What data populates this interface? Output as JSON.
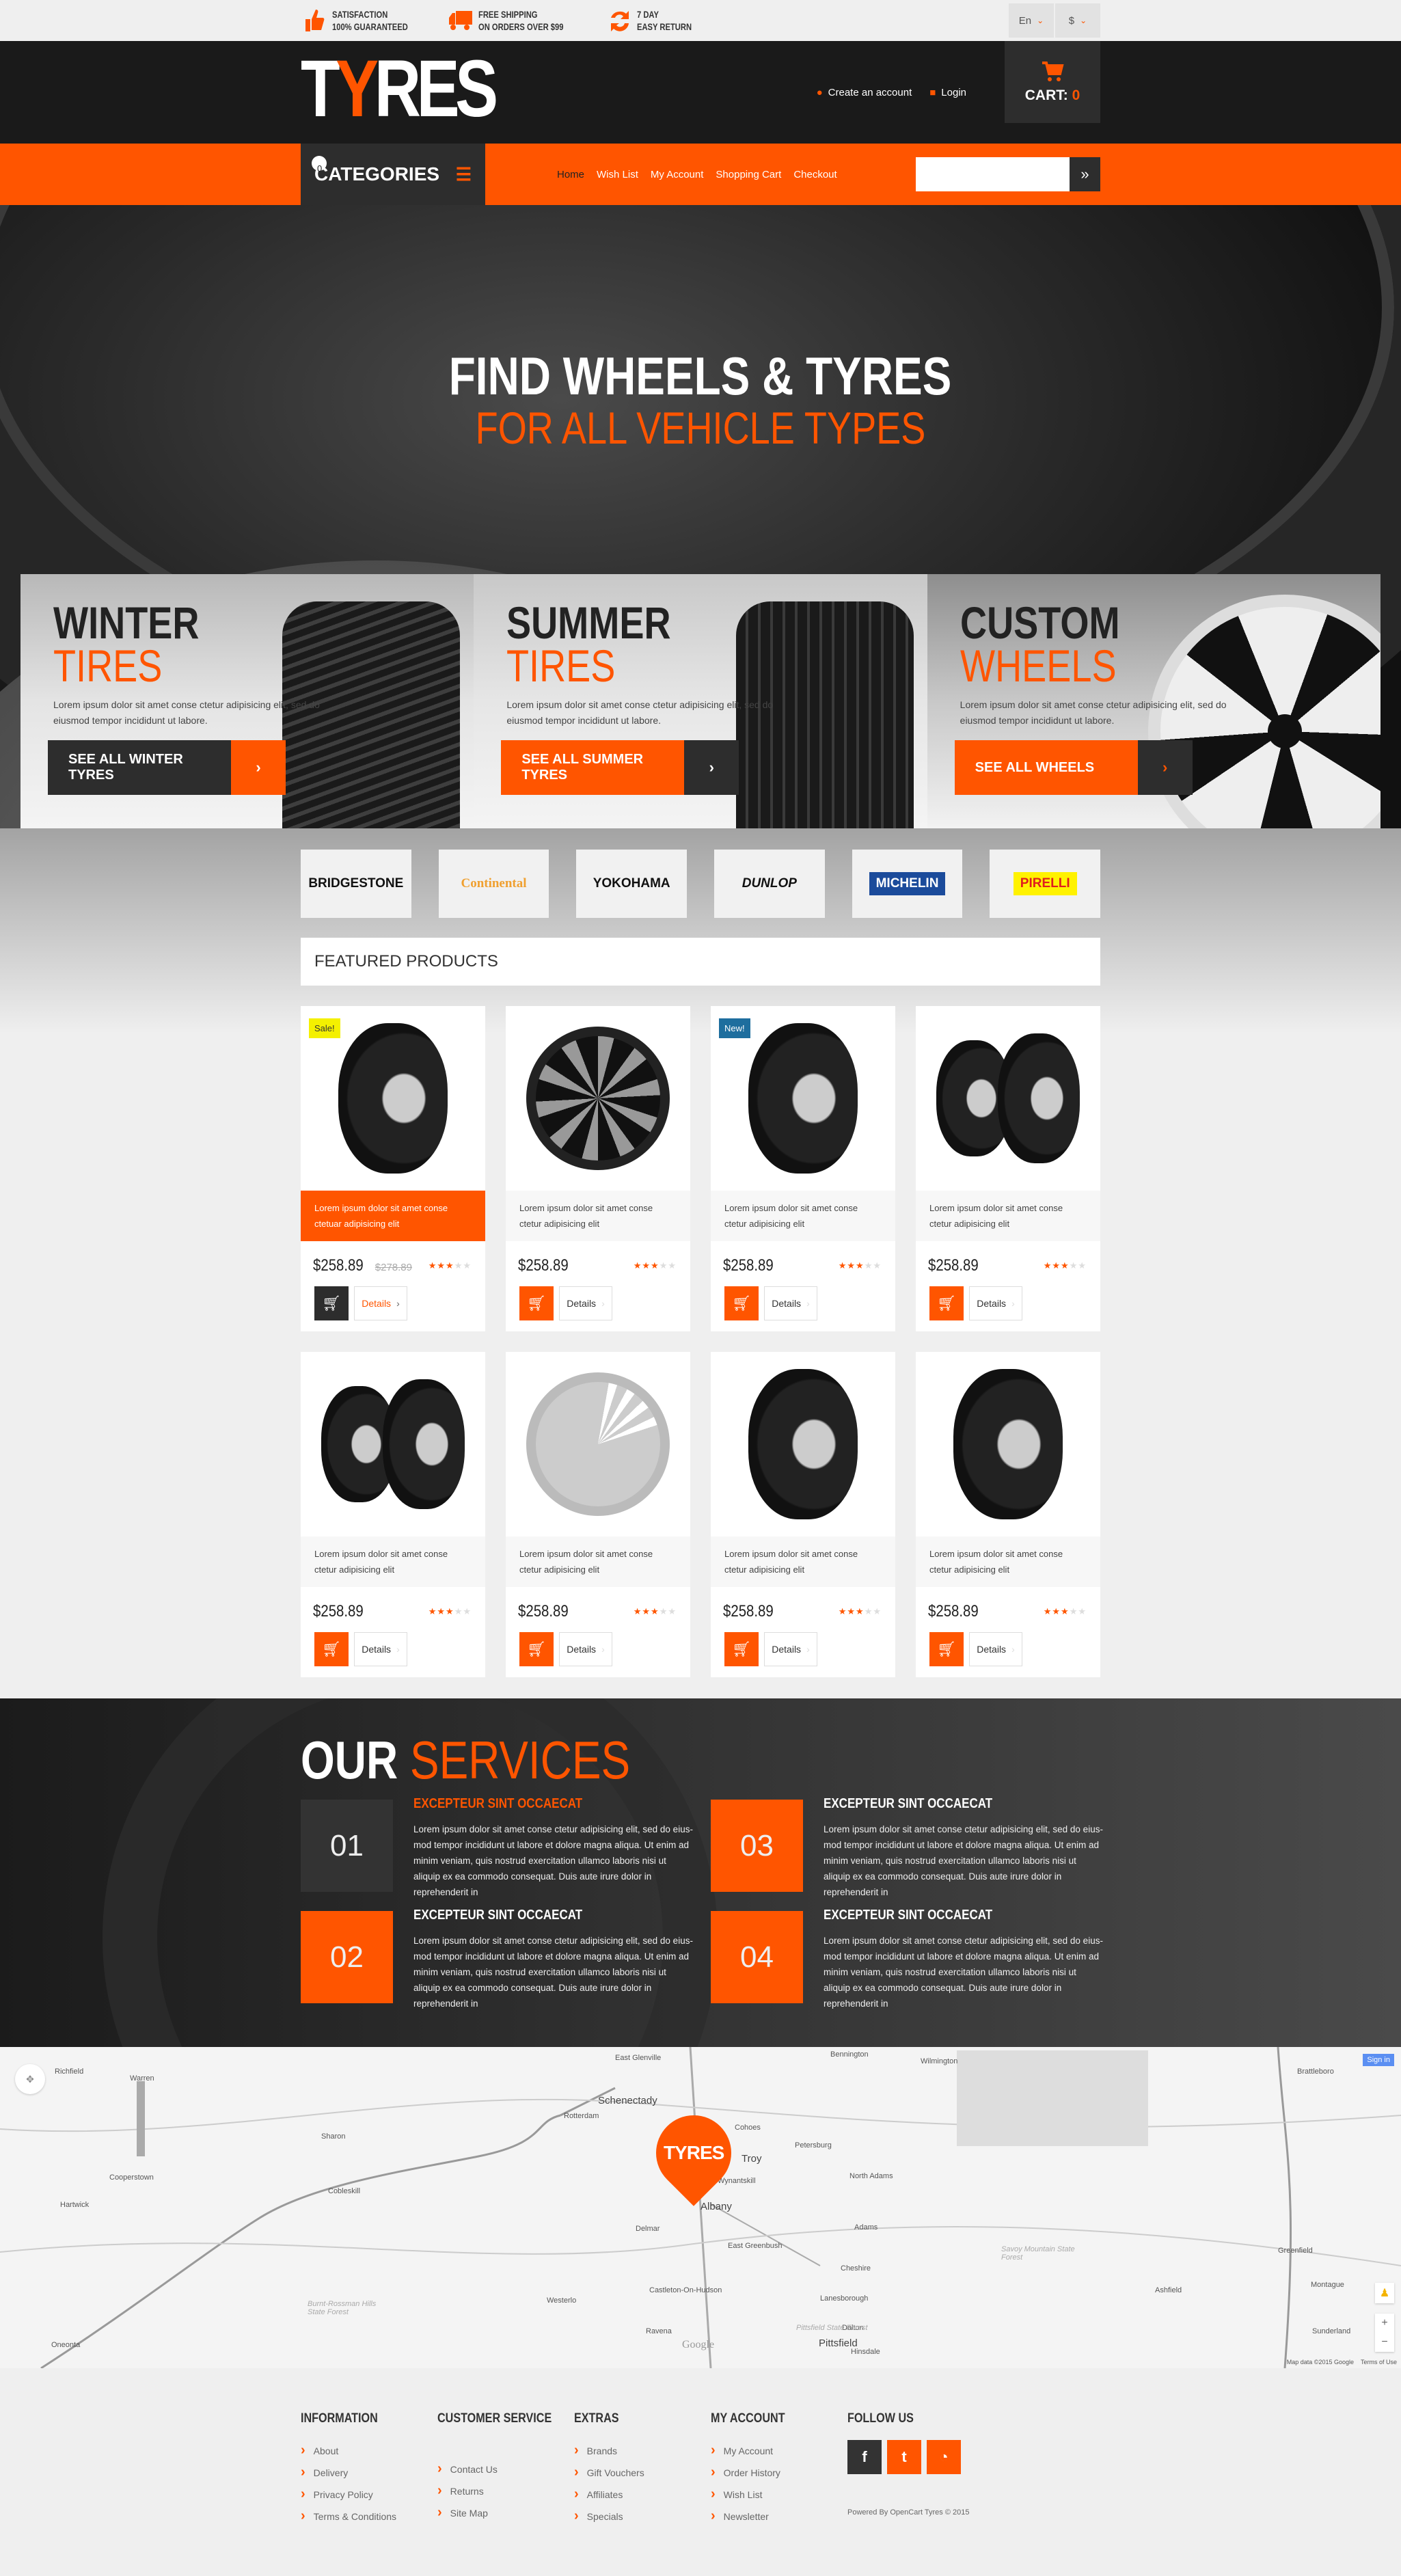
{
  "topbar": {
    "perks": [
      {
        "icon": "thumbs-up-icon",
        "line1": "Satisfaction",
        "line2": "100% Guaranteed"
      },
      {
        "icon": "truck-icon",
        "line1": "Free Shipping",
        "line2": "On orders over $99"
      },
      {
        "icon": "refresh-icon",
        "line1": "7 Day",
        "line2": "Easy Return"
      }
    ],
    "language": "En",
    "currency": "$"
  },
  "header": {
    "logo_prefix": "T",
    "logo_accent": "Y",
    "logo_suffix": "RES",
    "create_account": "Create an account",
    "login": "Login",
    "cart_label": "CART:",
    "cart_count": "0"
  },
  "nav": {
    "categories_label": "CATEGORIES",
    "menu": [
      {
        "label": "Home",
        "active": true
      },
      {
        "label": "Wish List",
        "badge": "0"
      },
      {
        "label": "My Account"
      },
      {
        "label": "Shopping Cart"
      },
      {
        "label": "Checkout"
      }
    ],
    "search_placeholder": "",
    "search_button": "»"
  },
  "hero": {
    "title_line1": "FIND WHEELS & TYRES",
    "title_line2": "FOR ALL VEHICLE TYPES",
    "prev_arrow": "‹",
    "next_arrow": "›"
  },
  "banners": [
    {
      "title": "WINTER",
      "subtitle": "TIRES",
      "text": "Lorem ipsum dolor sit amet conse ctetur adipisicing elit, sed do eiusmod tempor incididunt ut labore.",
      "button": "SEE ALL WINTER TYRES",
      "chevron": "›"
    },
    {
      "title": "SUMMER",
      "subtitle": "TIRES",
      "text": "Lorem ipsum dolor sit amet conse ctetur adipisicing elit, sed do eiusmod tempor incididunt ut labore.",
      "button": "SEE ALL SUMMER TYRES",
      "chevron": "›"
    },
    {
      "title": "CUSTOM",
      "subtitle": "WHEELS",
      "text": "Lorem ipsum dolor sit amet conse ctetur adipisicing elit, sed do eiusmod tempor incididunt ut labore.",
      "button": "SEE ALL WHEELS",
      "chevron": "›"
    }
  ],
  "brands": [
    {
      "name": "BRIDGESTONE",
      "color": "#111111"
    },
    {
      "name": "Continental",
      "color": "#f0a030"
    },
    {
      "name": "YOKOHAMA",
      "color": "#111111"
    },
    {
      "name": "DUNLOP",
      "color": "#111111"
    },
    {
      "name": "MICHELIN",
      "color": "#ffffff",
      "bg": "#1b4b9b"
    },
    {
      "name": "PIRELLI",
      "color": "#e01e1e",
      "bg": "#fff200"
    }
  ],
  "featured": {
    "heading": "FEATURED PRODUCTS",
    "details_label": "Details",
    "products": [
      {
        "badge": "Sale!",
        "desc1": "Lorem ipsum dolor sit amet conse",
        "desc2": "ctetuar adipisicing elit",
        "price": "$258.89",
        "old_price": "$278.89",
        "rating": 3,
        "max_rating": 5
      },
      {
        "desc1": "Lorem ipsum dolor sit amet conse",
        "desc2": "ctetur adipisicing elit",
        "price": "$258.89",
        "rating": 3,
        "max_rating": 5
      },
      {
        "badge": "New!",
        "desc1": "Lorem ipsum dolor sit amet conse",
        "desc2": "ctetur adipisicing elit",
        "price": "$258.89",
        "rating": 3,
        "max_rating": 5
      },
      {
        "desc1": "Lorem ipsum dolor sit amet conse",
        "desc2": "ctetur adipisicing elit",
        "price": "$258.89",
        "rating": 3,
        "max_rating": 5
      },
      {
        "desc1": "Lorem ipsum dolor sit amet conse",
        "desc2": "ctetur adipisicing elit",
        "price": "$258.89",
        "rating": 3,
        "max_rating": 5
      },
      {
        "desc1": "Lorem ipsum dolor sit amet conse",
        "desc2": "ctetur adipisicing elit",
        "price": "$258.89",
        "rating": 3,
        "max_rating": 5
      },
      {
        "desc1": "Lorem ipsum dolor sit amet conse",
        "desc2": "ctetur adipisicing elit",
        "price": "$258.89",
        "rating": 3,
        "max_rating": 5
      },
      {
        "desc1": "Lorem ipsum dolor sit amet conse",
        "desc2": "ctetur adipisicing elit",
        "price": "$258.89",
        "rating": 3,
        "max_rating": 5
      }
    ]
  },
  "services": {
    "title_white": "OUR",
    "title_orange": "SERVICES",
    "items": [
      {
        "num": "01",
        "heading": "EXCEPTEUR SINT OCCAECAT",
        "text": "Lorem ipsum dolor sit amet conse ctetur adipisicing elit, sed do eius-mod tempor incididunt ut labore et dolore magna aliqua. Ut enim ad minim veniam, quis nostrud exercitation ullamco laboris nisi ut aliquip ex ea commodo consequat. Duis aute irure dolor in reprehenderit in"
      },
      {
        "num": "02",
        "heading": "EXCEPTEUR SINT OCCAECAT",
        "text": "Lorem ipsum dolor sit amet conse ctetur adipisicing elit, sed do eius-mod tempor incididunt ut labore et dolore magna aliqua. Ut enim ad minim veniam, quis nostrud exercitation ullamco laboris nisi ut aliquip ex ea commodo consequat. Duis aute irure dolor in reprehenderit in"
      },
      {
        "num": "03",
        "heading": "EXCEPTEUR SINT OCCAECAT",
        "text": "Lorem ipsum dolor sit amet conse ctetur adipisicing elit, sed do eius-mod tempor incididunt ut labore et dolore magna aliqua. Ut enim ad minim veniam, quis nostrud exercitation ullamco laboris nisi ut aliquip ex ea commodo consequat. Duis aute irure dolor in reprehenderit in"
      },
      {
        "num": "04",
        "heading": "EXCEPTEUR SINT OCCAECAT",
        "text": "Lorem ipsum dolor sit amet conse ctetur adipisicing elit, sed do eius-mod tempor incididunt ut labore et dolore magna aliqua. Ut enim ad minim veniam, quis nostrud exercitation ullamco laboris nisi ut aliquip ex ea commodo consequat. Duis aute irure dolor in reprehenderit in"
      }
    ]
  },
  "map": {
    "marker_label": "TYRES",
    "sign_in": "Sign in",
    "attribution": "Map data ©2015 Google",
    "terms": "Terms of Use",
    "logo": "Google",
    "places": [
      "Richfield",
      "Warren",
      "Sharon",
      "Cooperstown",
      "Hartwick",
      "Cobleskill",
      "Oneonta",
      "Westerlo",
      "Schenectady",
      "Rotterdam",
      "East Glenville",
      "Cohoes",
      "Troy",
      "Albany",
      "Delmar",
      "Wynantskill",
      "East Greenbush",
      "Castleton-On-Hudson",
      "Ravena",
      "Bennington",
      "Petersburg",
      "North Adams",
      "Adams",
      "Cheshire",
      "Lanesborough",
      "Pittsfield",
      "Dalton",
      "Hinsdale",
      "Wilmington",
      "Brattleboro",
      "Greenfield",
      "Montague",
      "Sunderland",
      "Ashfield",
      "Burnt-Rossman Hills State Forest",
      "Savoy Mountain State Forest",
      "Pittsfield State Forest"
    ]
  },
  "footer": {
    "columns": [
      {
        "heading": "INFORMATION",
        "links": [
          "About",
          "Delivery",
          "Privacy Policy",
          "Terms & Conditions"
        ]
      },
      {
        "heading": "CUSTOMER SERVICE",
        "links": [
          "Contact Us",
          "Returns",
          "Site Map"
        ]
      },
      {
        "heading": "EXTRAS",
        "links": [
          "Brands",
          "Gift Vouchers",
          "Affiliates",
          "Specials"
        ]
      },
      {
        "heading": "MY ACCOUNT",
        "links": [
          "My Account",
          "Order History",
          "Wish List",
          "Newsletter"
        ]
      }
    ],
    "follow_heading": "FOLLOW US",
    "social": [
      {
        "name": "facebook",
        "glyph": "f"
      },
      {
        "name": "twitter",
        "glyph": "t"
      },
      {
        "name": "rss",
        "glyph": "◔"
      }
    ],
    "powered_by": "Powered By OpenCart Tyres © 2015"
  },
  "colors": {
    "accent": "#ff5500",
    "dark": "#2d2d2d",
    "header": "#1a1a1a",
    "new_badge": "#1e6e9e",
    "sale_badge": "#f4f000"
  }
}
